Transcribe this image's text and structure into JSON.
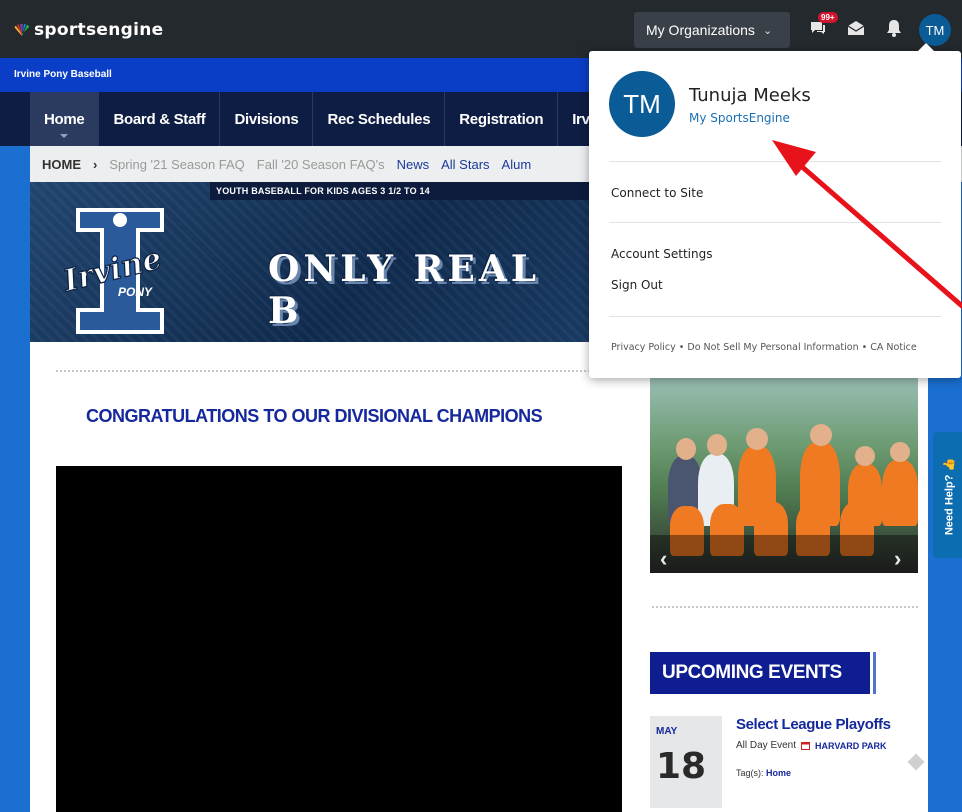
{
  "topbar": {
    "logo": "sportsengine",
    "org_button": "My Organizations",
    "notif_badge": "99+",
    "avatar_initials": "TM"
  },
  "site": {
    "name": "Irvine Pony Baseball",
    "nav": [
      "Home",
      "Board & Staff",
      "Divisions",
      "Rec Schedules",
      "Registration",
      "Irvi"
    ],
    "breadcrumb": {
      "home": "HOME",
      "sep": "›",
      "items": [
        "Spring '21 Season FAQ",
        "Fall '20 Season FAQ's",
        "News",
        "All Stars",
        "Alum"
      ]
    }
  },
  "banner": {
    "strip": "YOUTH BASEBALL FOR KIDS AGES 3 1/2 TO 14",
    "logo_word": "Irvine",
    "logo_sub": "PONY",
    "slogan": "ONLY REAL B"
  },
  "main": {
    "headline": "CONGRATULATIONS TO OUR DIVISIONAL CHAMPIONS"
  },
  "events": {
    "title": "UPCOMING EVENTS",
    "item": {
      "month": "MAY",
      "day": "18",
      "name": "Select League Playoffs",
      "when": "All Day Event",
      "place": "HARVARD PARK",
      "tags_label": "Tag(s):",
      "tag": "Home"
    }
  },
  "help_tab": "Need Help? 👍",
  "dropdown": {
    "avatar_initials": "TM",
    "name": "Tunuja Meeks",
    "link": "My SportsEngine",
    "connect": "Connect to Site",
    "account": "Account Settings",
    "signout": "Sign Out",
    "footer": "Privacy Policy • Do Not Sell My Personal Information • CA Notice"
  },
  "colors": {
    "topbar": "#24292e",
    "site_blue": "#0b3ec6",
    "nav_navy": "#0e1d44",
    "accent": "#16299c",
    "annotation": "#e8121b"
  }
}
